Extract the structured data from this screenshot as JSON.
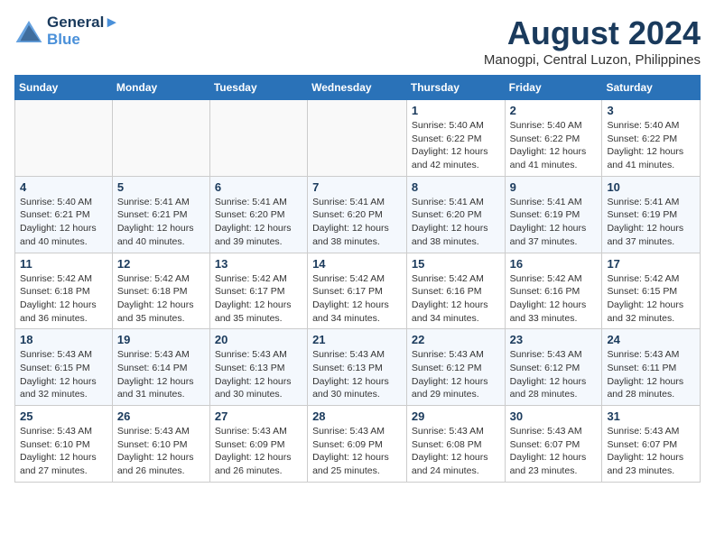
{
  "header": {
    "logo_line1": "General",
    "logo_line2": "Blue",
    "main_title": "August 2024",
    "subtitle": "Manogpi, Central Luzon, Philippines"
  },
  "weekdays": [
    "Sunday",
    "Monday",
    "Tuesday",
    "Wednesday",
    "Thursday",
    "Friday",
    "Saturday"
  ],
  "weeks": [
    [
      {
        "day": "",
        "info": ""
      },
      {
        "day": "",
        "info": ""
      },
      {
        "day": "",
        "info": ""
      },
      {
        "day": "",
        "info": ""
      },
      {
        "day": "1",
        "info": "Sunrise: 5:40 AM\nSunset: 6:22 PM\nDaylight: 12 hours\nand 42 minutes."
      },
      {
        "day": "2",
        "info": "Sunrise: 5:40 AM\nSunset: 6:22 PM\nDaylight: 12 hours\nand 41 minutes."
      },
      {
        "day": "3",
        "info": "Sunrise: 5:40 AM\nSunset: 6:22 PM\nDaylight: 12 hours\nand 41 minutes."
      }
    ],
    [
      {
        "day": "4",
        "info": "Sunrise: 5:40 AM\nSunset: 6:21 PM\nDaylight: 12 hours\nand 40 minutes."
      },
      {
        "day": "5",
        "info": "Sunrise: 5:41 AM\nSunset: 6:21 PM\nDaylight: 12 hours\nand 40 minutes."
      },
      {
        "day": "6",
        "info": "Sunrise: 5:41 AM\nSunset: 6:20 PM\nDaylight: 12 hours\nand 39 minutes."
      },
      {
        "day": "7",
        "info": "Sunrise: 5:41 AM\nSunset: 6:20 PM\nDaylight: 12 hours\nand 38 minutes."
      },
      {
        "day": "8",
        "info": "Sunrise: 5:41 AM\nSunset: 6:20 PM\nDaylight: 12 hours\nand 38 minutes."
      },
      {
        "day": "9",
        "info": "Sunrise: 5:41 AM\nSunset: 6:19 PM\nDaylight: 12 hours\nand 37 minutes."
      },
      {
        "day": "10",
        "info": "Sunrise: 5:41 AM\nSunset: 6:19 PM\nDaylight: 12 hours\nand 37 minutes."
      }
    ],
    [
      {
        "day": "11",
        "info": "Sunrise: 5:42 AM\nSunset: 6:18 PM\nDaylight: 12 hours\nand 36 minutes."
      },
      {
        "day": "12",
        "info": "Sunrise: 5:42 AM\nSunset: 6:18 PM\nDaylight: 12 hours\nand 35 minutes."
      },
      {
        "day": "13",
        "info": "Sunrise: 5:42 AM\nSunset: 6:17 PM\nDaylight: 12 hours\nand 35 minutes."
      },
      {
        "day": "14",
        "info": "Sunrise: 5:42 AM\nSunset: 6:17 PM\nDaylight: 12 hours\nand 34 minutes."
      },
      {
        "day": "15",
        "info": "Sunrise: 5:42 AM\nSunset: 6:16 PM\nDaylight: 12 hours\nand 34 minutes."
      },
      {
        "day": "16",
        "info": "Sunrise: 5:42 AM\nSunset: 6:16 PM\nDaylight: 12 hours\nand 33 minutes."
      },
      {
        "day": "17",
        "info": "Sunrise: 5:42 AM\nSunset: 6:15 PM\nDaylight: 12 hours\nand 32 minutes."
      }
    ],
    [
      {
        "day": "18",
        "info": "Sunrise: 5:43 AM\nSunset: 6:15 PM\nDaylight: 12 hours\nand 32 minutes."
      },
      {
        "day": "19",
        "info": "Sunrise: 5:43 AM\nSunset: 6:14 PM\nDaylight: 12 hours\nand 31 minutes."
      },
      {
        "day": "20",
        "info": "Sunrise: 5:43 AM\nSunset: 6:13 PM\nDaylight: 12 hours\nand 30 minutes."
      },
      {
        "day": "21",
        "info": "Sunrise: 5:43 AM\nSunset: 6:13 PM\nDaylight: 12 hours\nand 30 minutes."
      },
      {
        "day": "22",
        "info": "Sunrise: 5:43 AM\nSunset: 6:12 PM\nDaylight: 12 hours\nand 29 minutes."
      },
      {
        "day": "23",
        "info": "Sunrise: 5:43 AM\nSunset: 6:12 PM\nDaylight: 12 hours\nand 28 minutes."
      },
      {
        "day": "24",
        "info": "Sunrise: 5:43 AM\nSunset: 6:11 PM\nDaylight: 12 hours\nand 28 minutes."
      }
    ],
    [
      {
        "day": "25",
        "info": "Sunrise: 5:43 AM\nSunset: 6:10 PM\nDaylight: 12 hours\nand 27 minutes."
      },
      {
        "day": "26",
        "info": "Sunrise: 5:43 AM\nSunset: 6:10 PM\nDaylight: 12 hours\nand 26 minutes."
      },
      {
        "day": "27",
        "info": "Sunrise: 5:43 AM\nSunset: 6:09 PM\nDaylight: 12 hours\nand 26 minutes."
      },
      {
        "day": "28",
        "info": "Sunrise: 5:43 AM\nSunset: 6:09 PM\nDaylight: 12 hours\nand 25 minutes."
      },
      {
        "day": "29",
        "info": "Sunrise: 5:43 AM\nSunset: 6:08 PM\nDaylight: 12 hours\nand 24 minutes."
      },
      {
        "day": "30",
        "info": "Sunrise: 5:43 AM\nSunset: 6:07 PM\nDaylight: 12 hours\nand 23 minutes."
      },
      {
        "day": "31",
        "info": "Sunrise: 5:43 AM\nSunset: 6:07 PM\nDaylight: 12 hours\nand 23 minutes."
      }
    ]
  ]
}
